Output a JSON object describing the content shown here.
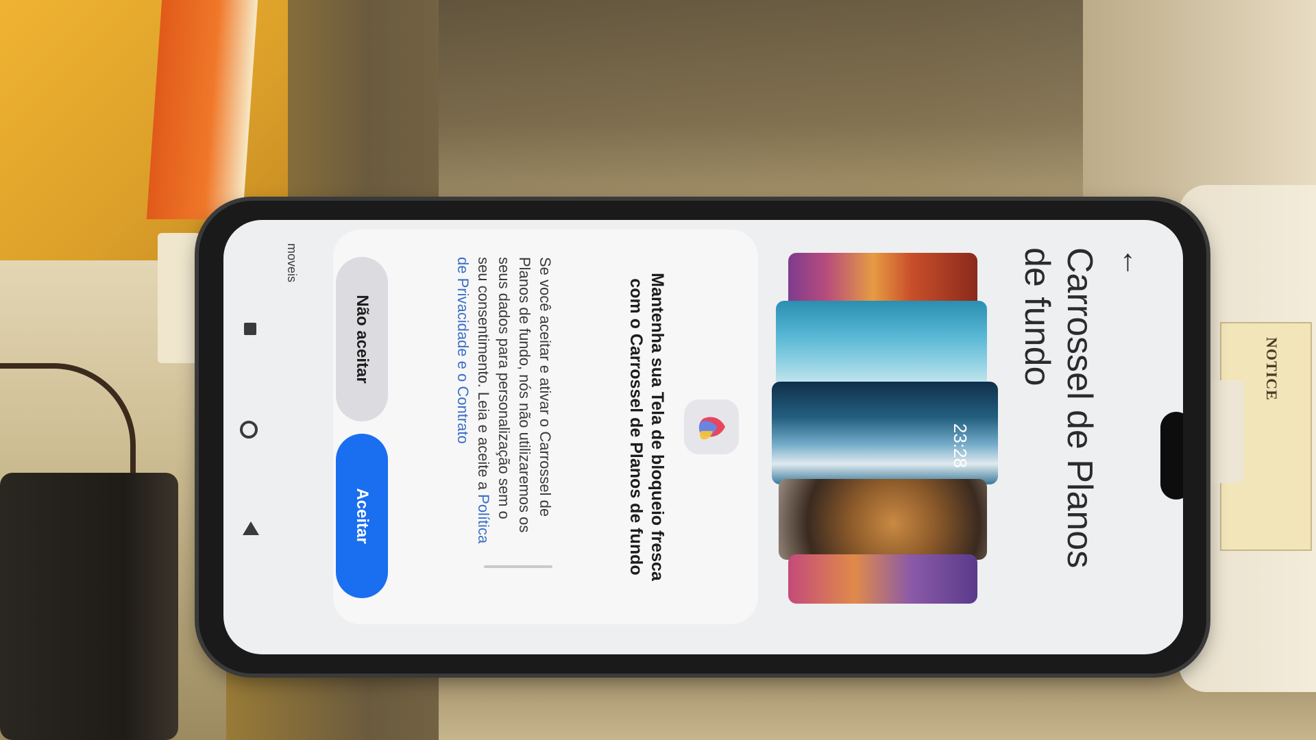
{
  "page": {
    "back_glyph": "←",
    "title": "Carrossel de Planos de fundo"
  },
  "carousel": {
    "lock_time": "23:28"
  },
  "sheet": {
    "app_icon": "wallpaper-carousel-app-icon",
    "title": "Mantenha sua Tela de bloqueio fresca com o Carrossel de Planos de fundo",
    "body": "Se você aceitar e ativar o Carrossel de Planos de fundo, nós não utilizaremos os seus dados para personalização sem o seu consentimento. Leia e aceite a",
    "link": "Política de Privacidade e o Contrato",
    "decline_label": "Não aceitar",
    "accept_label": "Aceitar"
  },
  "nav": {
    "side_text": "moveis"
  },
  "background": {
    "label_text": "NOTICE"
  },
  "colors": {
    "accent": "#1a6ef0",
    "link": "#3b6fc4",
    "screen_bg": "#eeeff1"
  }
}
